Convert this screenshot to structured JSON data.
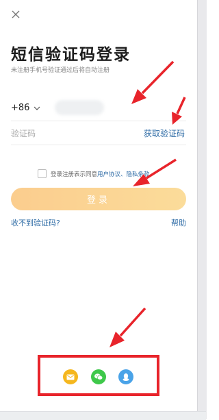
{
  "page": {
    "title": "短信验证码登录",
    "subtitle": "未注册手机号验证通过后将自动注册"
  },
  "phone": {
    "country_code": "+86"
  },
  "code": {
    "placeholder": "验证码",
    "get_code_label": "获取验证码"
  },
  "agreement": {
    "text": "登录注册表示同意",
    "link_text": "用户协议、隐私条款"
  },
  "login_button": "登录",
  "footer": {
    "no_code": "收不到验证码?",
    "help": "帮助"
  },
  "third_party": [
    {
      "icon": "mail-icon",
      "color": "#f5b71e"
    },
    {
      "icon": "wechat-icon",
      "color": "#3ec84a"
    },
    {
      "icon": "qq-icon",
      "color": "#4aa3e8"
    }
  ],
  "colors": {
    "accent_link": "#2f6ca6",
    "button_gradient_start": "#fbcd8e",
    "button_gradient_end": "#fbdc9a",
    "annotation_red": "#e8242b"
  }
}
